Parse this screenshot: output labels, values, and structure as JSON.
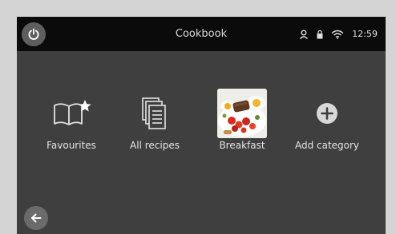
{
  "header": {
    "title": "Cookbook",
    "time": "12:59"
  },
  "status_icons": [
    "user-icon",
    "lock-icon",
    "wifi-icon"
  ],
  "categories": [
    {
      "label": "Favourites",
      "icon": "book-star-icon"
    },
    {
      "label": "All recipes",
      "icon": "recipe-list-icon"
    },
    {
      "label": "Breakfast",
      "icon": "breakfast-photo"
    },
    {
      "label": "Add category",
      "icon": "plus-circle-icon"
    }
  ],
  "colors": {
    "bezel": "#d4d4d4",
    "screen": "#3f3f3f",
    "topbar": "#0b0b0b",
    "text": "#e4e4e4"
  }
}
